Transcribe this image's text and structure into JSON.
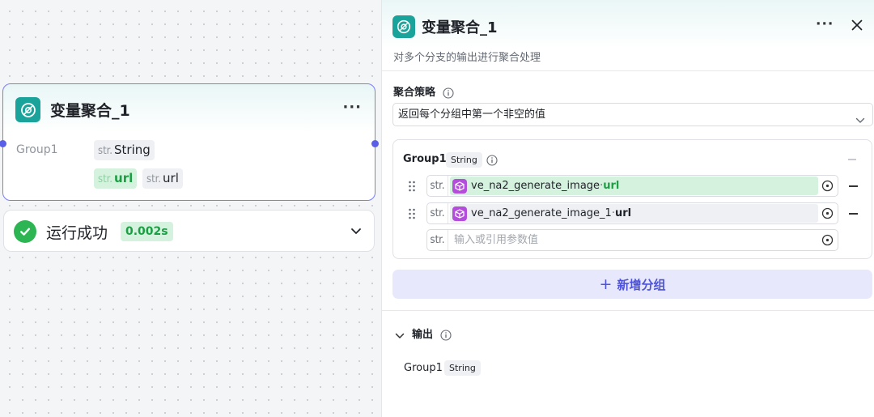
{
  "node": {
    "title": "变量聚合_1",
    "more": "···",
    "group_label": "Group1",
    "tags": [
      {
        "prefix": "str.",
        "value": "String"
      },
      {
        "prefix": "str.",
        "value": "url"
      },
      {
        "prefix": "str.",
        "value": "url"
      }
    ]
  },
  "run": {
    "status": "运行成功",
    "duration": "0.002s"
  },
  "panel": {
    "title": "变量聚合_1",
    "more": "···",
    "description": "对多个分支的输出进行聚合处理",
    "strategy_label": "聚合策略",
    "strategy_value": "返回每个分组中第一个非空的值",
    "group": {
      "name": "Group1",
      "type": "String",
      "rows": [
        {
          "prefix": "str.",
          "source": "ve_na2_generate_image",
          "sep": " · ",
          "field": "url"
        },
        {
          "prefix": "str.",
          "source": "ve_na2_generate_image_1",
          "sep": " · ",
          "field": "url"
        }
      ],
      "empty_row": {
        "prefix": "str.",
        "placeholder": "输入或引用参数值"
      }
    },
    "add_group_label": "新增分组",
    "output_label": "输出",
    "output": {
      "name": "Group1",
      "type": "String"
    }
  },
  "colors": {
    "accent": "#5a5fe8",
    "node_icon": "#1aa39a",
    "success": "#2db553",
    "success_text": "#1d9e44",
    "plugin_icon": "#b44ddb"
  }
}
